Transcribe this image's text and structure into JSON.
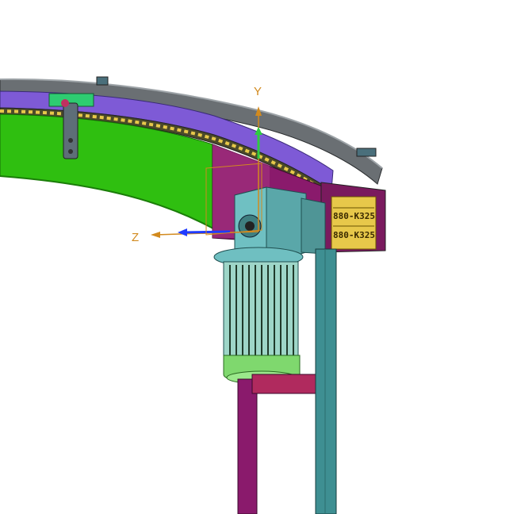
{
  "viewport": {
    "background": "#ffffff"
  },
  "axes": {
    "y_label": "Y",
    "z_label": "Z",
    "label_color": "#d28a1e",
    "y_color": "#2ecc40",
    "z_color": "#1f3bff"
  },
  "part_labels": {
    "chain_label_1": "880-K325",
    "chain_label_2": "880-K325"
  },
  "colors": {
    "guide_rail": "#6a6f73",
    "side_plate": "#7e5ad6",
    "belt_surface": "#2fbf10",
    "chain_links": "#e7c84a",
    "motor_housing": "#5aa7a9",
    "motor_cap": "#7fd86e",
    "support_frame": "#8a1a6c",
    "support_leg": "#3e8f92"
  }
}
